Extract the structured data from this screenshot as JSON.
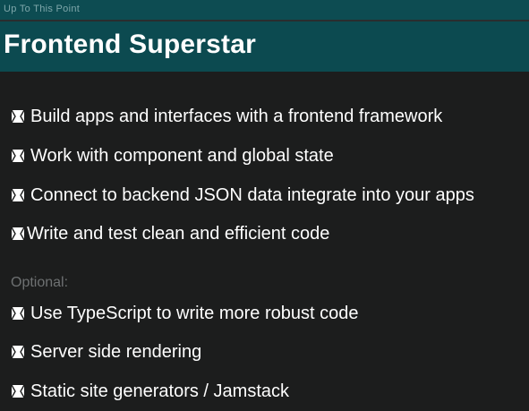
{
  "header": {
    "section_label": "Up To This Point",
    "title": "Frontend Superstar"
  },
  "bullet_icon": "bullet-square-icon",
  "main_items": [
    "Build apps and interfaces with a frontend framework",
    "Work with component and global state",
    "Connect to backend JSON data integrate into your apps",
    "Write and test clean and efficient code"
  ],
  "optional": {
    "label": "Optional:",
    "items": [
      "Use TypeScript to write more robust code",
      "Server side rendering",
      "Static site generators / Jamstack"
    ]
  },
  "colors": {
    "background": "#1c1d1d",
    "header_teal": "#0c4a50",
    "text": "#ffffff",
    "muted": "#6e7172"
  }
}
